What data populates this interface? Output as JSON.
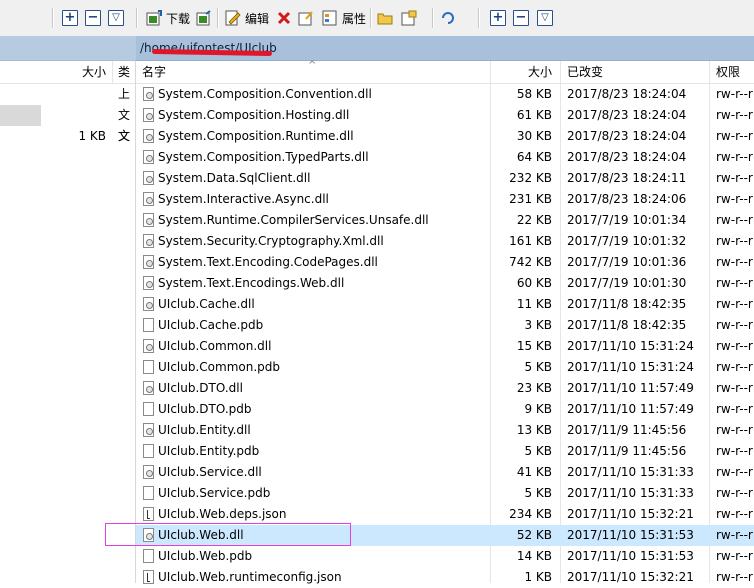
{
  "toolbar": {
    "download_label": "下载",
    "edit_label": "编辑",
    "properties_label": "属性"
  },
  "path": {
    "text": "/home/uifontest/UIclub"
  },
  "left_pane": {
    "columns": {
      "size": "大小",
      "type": "类"
    },
    "rows": [
      {
        "size": "",
        "type": "上"
      },
      {
        "size": "",
        "type": "文"
      },
      {
        "size": "",
        "type": "文"
      },
      {
        "size": "1 KB",
        "type": "文"
      }
    ]
  },
  "file_list": {
    "columns": {
      "name": "名字",
      "size": "大小",
      "modified": "已改变",
      "permissions": "权限"
    },
    "rows": [
      {
        "name": "System.Composition.Convention.dll",
        "size": "58 KB",
        "modified": "2017/8/23 18:24:04",
        "perm": "rw-r--r",
        "icon": "dll-file-icon"
      },
      {
        "name": "System.Composition.Hosting.dll",
        "size": "61 KB",
        "modified": "2017/8/23 18:24:04",
        "perm": "rw-r--r",
        "icon": "dll-file-icon"
      },
      {
        "name": "System.Composition.Runtime.dll",
        "size": "30 KB",
        "modified": "2017/8/23 18:24:04",
        "perm": "rw-r--r",
        "icon": "dll-file-icon"
      },
      {
        "name": "System.Composition.TypedParts.dll",
        "size": "64 KB",
        "modified": "2017/8/23 18:24:04",
        "perm": "rw-r--r",
        "icon": "dll-file-icon"
      },
      {
        "name": "System.Data.SqlClient.dll",
        "size": "232 KB",
        "modified": "2017/8/23 18:24:11",
        "perm": "rw-r--r",
        "icon": "dll-file-icon"
      },
      {
        "name": "System.Interactive.Async.dll",
        "size": "231 KB",
        "modified": "2017/8/23 18:24:06",
        "perm": "rw-r--r",
        "icon": "dll-file-icon"
      },
      {
        "name": "System.Runtime.CompilerServices.Unsafe.dll",
        "size": "22 KB",
        "modified": "2017/7/19 10:01:34",
        "perm": "rw-r--r",
        "icon": "dll-file-icon"
      },
      {
        "name": "System.Security.Cryptography.Xml.dll",
        "size": "161 KB",
        "modified": "2017/7/19 10:01:32",
        "perm": "rw-r--r",
        "icon": "dll-file-icon"
      },
      {
        "name": "System.Text.Encoding.CodePages.dll",
        "size": "742 KB",
        "modified": "2017/7/19 10:01:36",
        "perm": "rw-r--r",
        "icon": "dll-file-icon"
      },
      {
        "name": "System.Text.Encodings.Web.dll",
        "size": "60 KB",
        "modified": "2017/7/19 10:01:30",
        "perm": "rw-r--r",
        "icon": "dll-file-icon"
      },
      {
        "name": "UIclub.Cache.dll",
        "size": "11 KB",
        "modified": "2017/11/8 18:42:35",
        "perm": "rw-r--r",
        "icon": "dll-file-icon"
      },
      {
        "name": "UIclub.Cache.pdb",
        "size": "3 KB",
        "modified": "2017/11/8 18:42:35",
        "perm": "rw-r--r",
        "icon": "file-icon"
      },
      {
        "name": "UIclub.Common.dll",
        "size": "15 KB",
        "modified": "2017/11/10 15:31:24",
        "perm": "rw-r--r",
        "icon": "dll-file-icon"
      },
      {
        "name": "UIclub.Common.pdb",
        "size": "5 KB",
        "modified": "2017/11/10 15:31:24",
        "perm": "rw-r--r",
        "icon": "file-icon"
      },
      {
        "name": "UIclub.DTO.dll",
        "size": "23 KB",
        "modified": "2017/11/10 11:57:49",
        "perm": "rw-r--r",
        "icon": "dll-file-icon"
      },
      {
        "name": "UIclub.DTO.pdb",
        "size": "9 KB",
        "modified": "2017/11/10 11:57:49",
        "perm": "rw-r--r",
        "icon": "file-icon"
      },
      {
        "name": "UIclub.Entity.dll",
        "size": "13 KB",
        "modified": "2017/11/9 11:45:56",
        "perm": "rw-r--r",
        "icon": "dll-file-icon"
      },
      {
        "name": "UIclub.Entity.pdb",
        "size": "5 KB",
        "modified": "2017/11/9 11:45:56",
        "perm": "rw-r--r",
        "icon": "file-icon"
      },
      {
        "name": "UIclub.Service.dll",
        "size": "41 KB",
        "modified": "2017/11/10 15:31:33",
        "perm": "rw-r--r",
        "icon": "dll-file-icon"
      },
      {
        "name": "UIclub.Service.pdb",
        "size": "5 KB",
        "modified": "2017/11/10 15:31:33",
        "perm": "rw-r--r",
        "icon": "file-icon"
      },
      {
        "name": "UIclub.Web.deps.json",
        "size": "234 KB",
        "modified": "2017/11/10 15:32:21",
        "perm": "rw-r--r",
        "icon": "json-file-icon"
      },
      {
        "name": "UIclub.Web.dll",
        "size": "52 KB",
        "modified": "2017/11/10 15:31:53",
        "perm": "rw-r--r",
        "icon": "dll-file-icon",
        "selected": true
      },
      {
        "name": "UIclub.Web.pdb",
        "size": "14 KB",
        "modified": "2017/11/10 15:31:53",
        "perm": "rw-r--r",
        "icon": "file-icon"
      },
      {
        "name": "UIclub.Web.runtimeconfig.json",
        "size": "1 KB",
        "modified": "2017/11/10 15:32:21",
        "perm": "rw-r--r",
        "icon": "json-file-icon"
      }
    ]
  }
}
